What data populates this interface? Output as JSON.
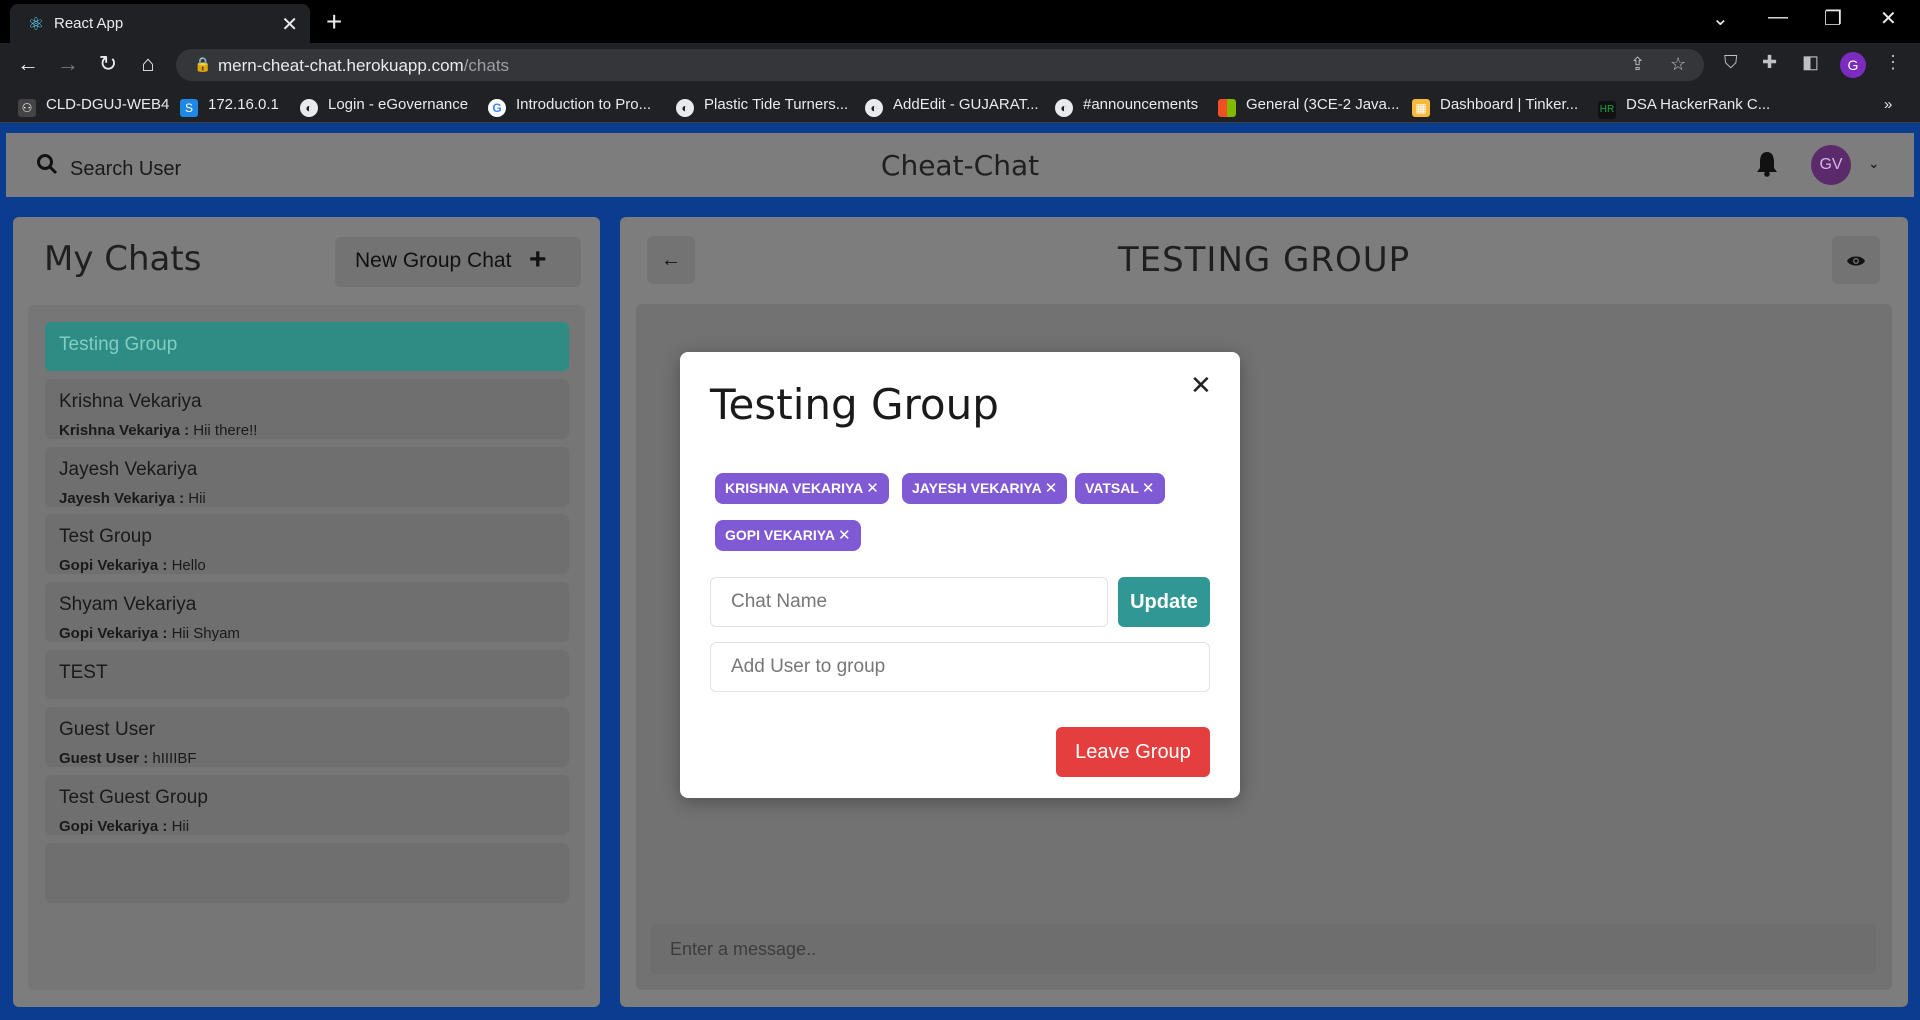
{
  "browser": {
    "tab_title": "React App",
    "url_host": "mern-cheat-chat.herokuapp.com",
    "url_path": "/chats",
    "profile_initial": "G",
    "bookmarks": [
      {
        "label": "CLD-DGUJ-WEB4"
      },
      {
        "label": "172.16.0.1"
      },
      {
        "label": "Login - eGovernance"
      },
      {
        "label": "Introduction to Pro..."
      },
      {
        "label": "Plastic Tide Turners..."
      },
      {
        "label": "AddEdit - GUJARAT..."
      },
      {
        "label": "#announcements"
      },
      {
        "label": "General (3CE-2 Java..."
      },
      {
        "label": "Dashboard | Tinker..."
      },
      {
        "label": "DSA HackerRank C..."
      }
    ],
    "more_bookmarks": "»"
  },
  "header": {
    "search_label": "Search User",
    "app_title": "Cheat-Chat",
    "avatar_initials": "GV"
  },
  "my_chats": {
    "title": "My Chats",
    "new_group_label": "New Group Chat",
    "items": [
      {
        "name": "Testing Group",
        "sender": "",
        "message": ""
      },
      {
        "name": "Krishna Vekariya",
        "sender": "Krishna Vekariya : ",
        "message": "Hii there!!"
      },
      {
        "name": "Jayesh Vekariya",
        "sender": "Jayesh Vekariya : ",
        "message": "Hii"
      },
      {
        "name": "Test Group",
        "sender": "Gopi Vekariya : ",
        "message": "Hello"
      },
      {
        "name": "Shyam Vekariya",
        "sender": "Gopi Vekariya : ",
        "message": "Hii Shyam"
      },
      {
        "name": "TEST",
        "sender": "",
        "message": ""
      },
      {
        "name": "Guest User",
        "sender": "Guest User : ",
        "message": "hIIIIBF"
      },
      {
        "name": "Test Guest Group",
        "sender": "Gopi Vekariya : ",
        "message": "Hii"
      }
    ]
  },
  "chat": {
    "title": "TESTING GROUP",
    "message_placeholder": "Enter a message.."
  },
  "modal": {
    "title": "Testing Group",
    "members": [
      "KRISHNA VEKARIYA",
      "JAYESH VEKARIYA",
      "VATSAL",
      "GOPI VEKARIYA"
    ],
    "chat_name_placeholder": "Chat Name",
    "update_label": "Update",
    "add_user_placeholder": "Add User to group",
    "leave_label": "Leave Group"
  },
  "colors": {
    "active_chat": "#2f8c84",
    "badge": "#805ad5",
    "update_button": "#319795",
    "leave_button": "#e53e3e"
  }
}
